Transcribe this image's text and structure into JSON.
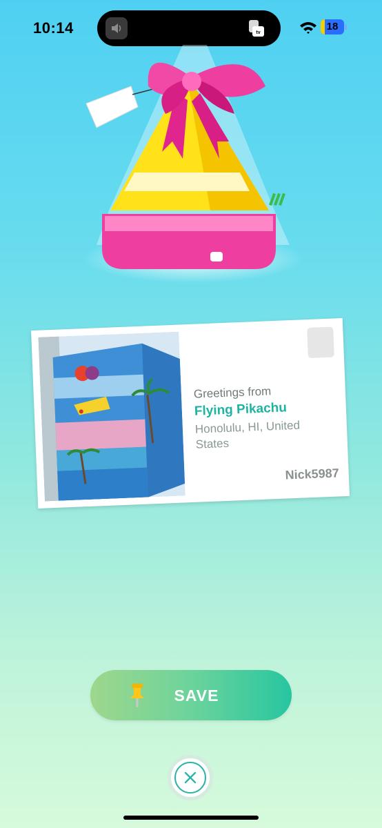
{
  "status_bar": {
    "time": "10:14",
    "battery": "18"
  },
  "postcard": {
    "greeting": "Greetings from",
    "pokemon": "Flying Pikachu",
    "location": "Honolulu, HI, United States",
    "trainer": "Nick5987"
  },
  "save_button": {
    "label": "SAVE"
  },
  "colors": {
    "accent": "#1fb3a4",
    "gift_pink": "#ee3fa0",
    "gift_yellow": "#ffe21a",
    "save_gradient_start": "#9ed78c",
    "save_gradient_end": "#27c6a0"
  },
  "icons": [
    "volume-icon",
    "apple-tv-icon",
    "wifi-icon",
    "battery-icon",
    "pushpin-icon",
    "close-icon"
  ]
}
